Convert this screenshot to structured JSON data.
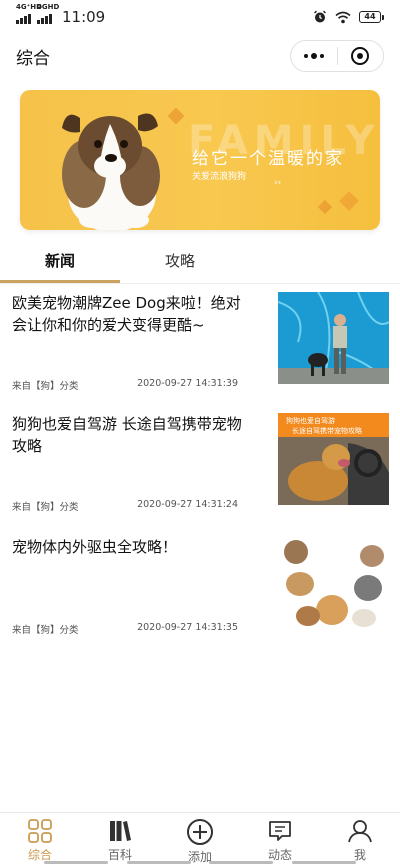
{
  "status_bar": {
    "signal1_label": "4G⁺HD",
    "signal2_label": "4GHD",
    "time": "11:09",
    "battery": "44"
  },
  "header": {
    "title": "综合"
  },
  "banner": {
    "watermark": "FAMILY",
    "slogan": "给它一个温暖的家",
    "subtitle": "关爱流浪狗狗",
    "chevron": "››"
  },
  "tabs": [
    {
      "label": "新闻",
      "active": true
    },
    {
      "label": "攻略",
      "active": false
    }
  ],
  "news": [
    {
      "title": "欧美宠物潮牌Zee Dog来啦！绝对会让你和你的爱犬变得更酷~",
      "source": "来自【狗】分类",
      "time": "2020-09-27 14:31:39"
    },
    {
      "title": "狗狗也爱自驾游 长途自驾携带宠物攻略",
      "source": "来自【狗】分类",
      "time": "2020-09-27 14:31:24",
      "thumb_caption_1": "狗狗也爱自驾游",
      "thumb_caption_2": "长途自驾携带宠物攻略"
    },
    {
      "title": "宠物体内外驱虫全攻略！",
      "source": "来自【狗】分类",
      "time": "2020-09-27 14:31:35"
    }
  ],
  "bottom_nav": [
    {
      "label": "综合",
      "icon": "grid-icon",
      "active": true
    },
    {
      "label": "百科",
      "icon": "books-icon",
      "active": false
    },
    {
      "label": "添加",
      "icon": "add-circle-icon",
      "active": false
    },
    {
      "label": "动态",
      "icon": "message-icon",
      "active": false
    },
    {
      "label": "我",
      "icon": "person-icon",
      "active": false
    }
  ],
  "colors": {
    "accent": "#c99a4e",
    "banner_yellow": "#f8c84f"
  }
}
